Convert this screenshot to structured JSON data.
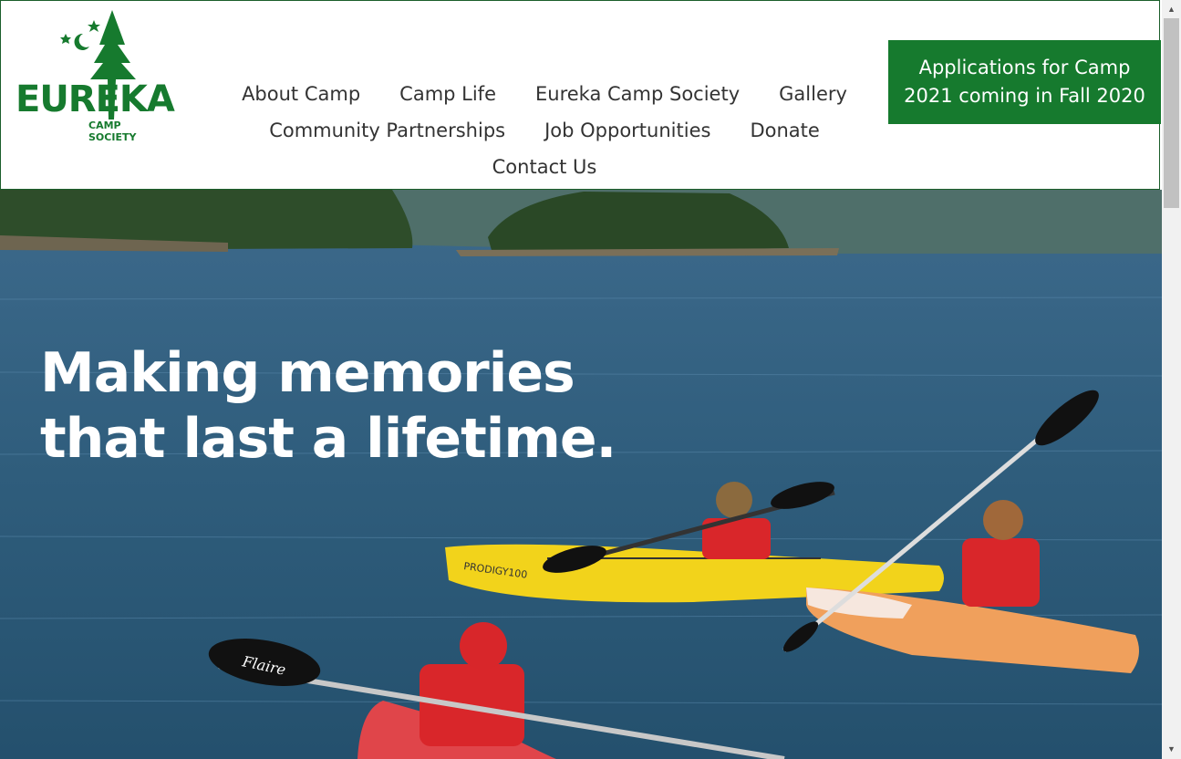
{
  "logo": {
    "name": "EUREKA",
    "tagline": "CAMP SOCIETY"
  },
  "nav": {
    "row1": [
      "About Camp",
      "Camp Life",
      "Eureka Camp Society",
      "Gallery"
    ],
    "row2": [
      "Community Partnerships",
      "Job Opportunities",
      "Donate"
    ],
    "row3": [
      "Contact Us"
    ]
  },
  "cta": {
    "label": "Applications for Camp 2021 coming in Fall 2020"
  },
  "hero": {
    "line1": "Making memories",
    "line2": "that last a lifetime."
  },
  "photo_text": {
    "kayak_brand": "PRODIGY100",
    "paddle_brand": "Flaire"
  },
  "colors": {
    "brand_green": "#167a2e",
    "header_border": "#1b5e2b"
  }
}
